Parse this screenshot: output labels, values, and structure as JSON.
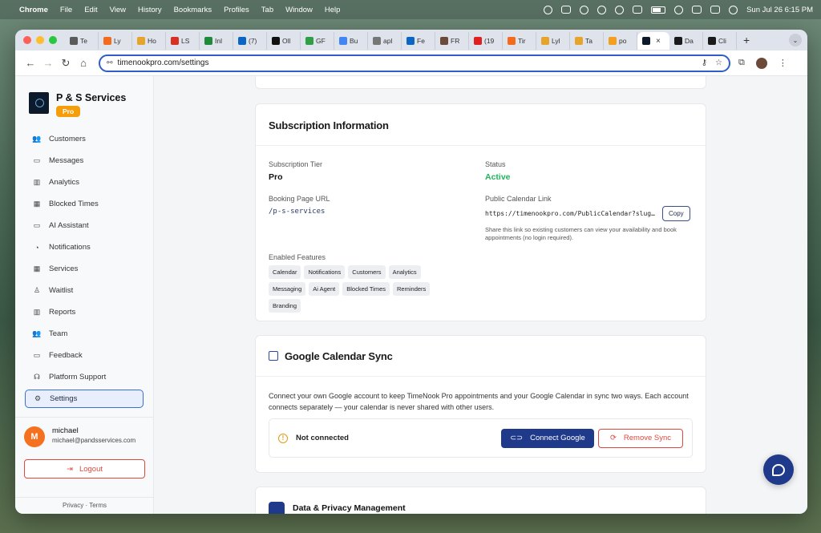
{
  "menubar": {
    "app": "Chrome",
    "items": [
      "File",
      "Edit",
      "View",
      "History",
      "Bookmarks",
      "Profiles",
      "Tab",
      "Window",
      "Help"
    ],
    "datetime": "Sun Jul 26  6:15 PM"
  },
  "browser": {
    "tabs": [
      {
        "label": "Te",
        "color": "#5a5a5a"
      },
      {
        "label": "Ly",
        "color": "#f46b1e"
      },
      {
        "label": "Ho",
        "color": "#e6a42a"
      },
      {
        "label": "LS",
        "color": "#d93025"
      },
      {
        "label": "Inl",
        "color": "#1e8a3a"
      },
      {
        "label": "(7)",
        "color": "#0a66c2"
      },
      {
        "label": "Oll",
        "color": "#111111"
      },
      {
        "label": "GF",
        "color": "#2f9e44"
      },
      {
        "label": "Bu",
        "color": "#4285f4"
      },
      {
        "label": "apl",
        "color": "#777777"
      },
      {
        "label": "Fe",
        "color": "#0a66c2"
      },
      {
        "label": "FR",
        "color": "#6b4a3a"
      },
      {
        "label": "(19",
        "color": "#e02020"
      },
      {
        "label": "Tir",
        "color": "#f46b1e"
      },
      {
        "label": "Lyl",
        "color": "#e6a42a"
      },
      {
        "label": "Ta",
        "color": "#e6a42a"
      },
      {
        "label": "po",
        "color": "#f4a01e"
      }
    ],
    "active_tab_close": "×",
    "more_tabs": [
      "Da",
      "Cli"
    ],
    "new_tab": "+",
    "url": "timenookpro.com/settings"
  },
  "sidebar": {
    "business_name": "P & S Services",
    "plan_badge": "Pro",
    "items": [
      {
        "label": "Customers",
        "icon": "users-icon",
        "glyph": "👥"
      },
      {
        "label": "Messages",
        "icon": "message-icon",
        "glyph": "▭"
      },
      {
        "label": "Analytics",
        "icon": "bar-chart-icon",
        "glyph": "▥"
      },
      {
        "label": "Blocked Times",
        "icon": "calendar-icon",
        "glyph": "▦"
      },
      {
        "label": "AI Assistant",
        "icon": "chat-bubble-icon",
        "glyph": "▭"
      },
      {
        "label": "Notifications",
        "icon": "bell-icon",
        "glyph": "◔"
      },
      {
        "label": "Services",
        "icon": "calendar-icon",
        "glyph": "▦"
      },
      {
        "label": "Waitlist",
        "icon": "user-plus-icon",
        "glyph": "♙"
      },
      {
        "label": "Reports",
        "icon": "bar-chart-icon",
        "glyph": "▥"
      },
      {
        "label": "Team",
        "icon": "users-icon",
        "glyph": "👥"
      },
      {
        "label": "Feedback",
        "icon": "message-icon",
        "glyph": "▭"
      },
      {
        "label": "Platform Support",
        "icon": "headset-icon",
        "glyph": "☊"
      },
      {
        "label": "Settings",
        "icon": "gear-icon",
        "glyph": "⚙"
      }
    ],
    "user": {
      "initial": "M",
      "name": "michael",
      "email": "michael@pandsservices.com"
    },
    "logout_label": "Logout",
    "footer": {
      "privacy": "Privacy",
      "separator": "·",
      "terms": "Terms"
    }
  },
  "subscription": {
    "title": "Subscription Information",
    "tier_label": "Subscription Tier",
    "tier_value": "Pro",
    "status_label": "Status",
    "status_value": "Active",
    "booking_label": "Booking Page URL",
    "booking_value": "/p-s-services",
    "calendar_link_label": "Public Calendar Link",
    "calendar_link_value": "https://timenookpro.com/PublicCalendar?slug=p-s-services",
    "copy_label": "Copy",
    "calendar_hint": "Share this link so existing customers can view your availability and book appointments (no login required).",
    "features_label": "Enabled Features",
    "features": [
      "Calendar",
      "Notifications",
      "Customers",
      "Analytics",
      "Messaging",
      "Ai Agent",
      "Blocked Times",
      "Reminders",
      "Branding"
    ]
  },
  "google_sync": {
    "title": "Google Calendar Sync",
    "description": "Connect your own Google account to keep TimeNook Pro appointments and your Google Calendar in sync two ways. Each account connects separately — your calendar is never shared with other users.",
    "status": "Not connected",
    "connect_label": "Connect Google",
    "remove_label": "Remove Sync"
  },
  "data_privacy": {
    "title": "Data & Privacy Management"
  },
  "colors": {
    "accent": "#1f3a8a",
    "active_green": "#22b35c",
    "danger": "#e0483f",
    "pro_badge": "#f59e0b",
    "avatar": "#f4711f"
  }
}
